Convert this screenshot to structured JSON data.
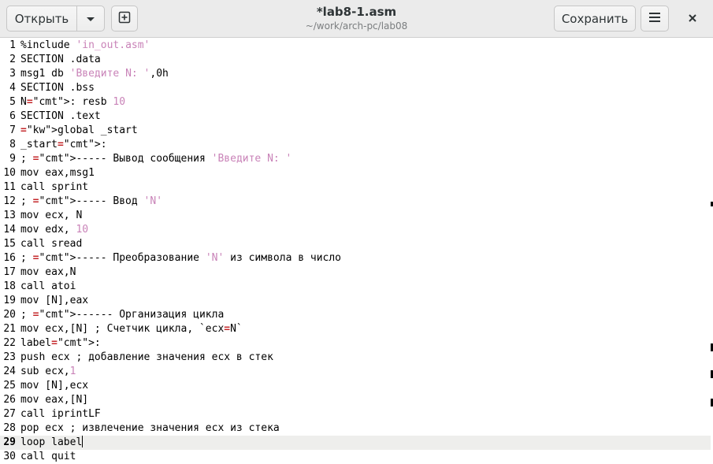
{
  "window": {
    "title": "*lab8-1.asm",
    "subtitle": "~/work/arch-pc/lab08"
  },
  "toolbar": {
    "open_label": "Открыть",
    "open_menu_icon": "chevron-down-icon",
    "new_tab_icon": "new-document-icon",
    "save_label": "Сохранить",
    "menu_icon": "hamburger-menu-icon",
    "close_icon": "close-icon"
  },
  "editor": {
    "current_line": 29,
    "lines": [
      {
        "n": "1",
        "text": "%include 'in_out.asm'"
      },
      {
        "n": "2",
        "text": "SECTION .data"
      },
      {
        "n": "3",
        "text": "msg1 db 'Введите N: ',0h"
      },
      {
        "n": "4",
        "text": "SECTION .bss"
      },
      {
        "n": "5",
        "text": "N: resb 10"
      },
      {
        "n": "6",
        "text": "SECTION .text"
      },
      {
        "n": "7",
        "text": "global _start"
      },
      {
        "n": "8",
        "text": "_start:"
      },
      {
        "n": "9",
        "text": "; ----- Вывод сообщения 'Введите N: '"
      },
      {
        "n": "10",
        "text": "mov eax,msg1"
      },
      {
        "n": "11",
        "text": "call sprint"
      },
      {
        "n": "12",
        "text": "; ----- Ввод 'N'"
      },
      {
        "n": "13",
        "text": "mov ecx, N"
      },
      {
        "n": "14",
        "text": "mov edx, 10"
      },
      {
        "n": "15",
        "text": "call sread"
      },
      {
        "n": "16",
        "text": "; ----- Преобразование 'N' из символа в число"
      },
      {
        "n": "17",
        "text": "mov eax,N"
      },
      {
        "n": "18",
        "text": "call atoi"
      },
      {
        "n": "19",
        "text": "mov [N],eax"
      },
      {
        "n": "20",
        "text": "; ------ Организация цикла"
      },
      {
        "n": "21",
        "text": "mov ecx,[N] ; Счетчик цикла, `ecx=N`"
      },
      {
        "n": "22",
        "text": "label:"
      },
      {
        "n": "23",
        "text": "push ecx ; добавление значения ecx в стек"
      },
      {
        "n": "24",
        "text": "sub ecx,1"
      },
      {
        "n": "25",
        "text": "mov [N],ecx"
      },
      {
        "n": "26",
        "text": "mov eax,[N]"
      },
      {
        "n": "27",
        "text": "call iprintLF"
      },
      {
        "n": "28",
        "text": "pop ecx ; извлечение значения ecx из стека"
      },
      {
        "n": "29",
        "text": "loop label"
      },
      {
        "n": "30",
        "text": "call quit"
      }
    ]
  },
  "colors": {
    "keyword": "#4e9a06",
    "string": "#c983b8",
    "comment_dashes": "#c4282b",
    "current_line_bg": "#eeeeec",
    "headerbar_bg": "#ebebeb"
  }
}
